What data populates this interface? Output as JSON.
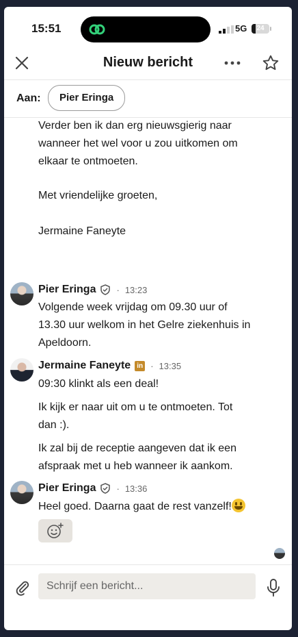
{
  "status_bar": {
    "time": "15:51",
    "network": "5G",
    "battery": "24",
    "battery_level": 0.24
  },
  "header": {
    "title": "Nieuw bericht"
  },
  "recipient": {
    "label": "Aan:",
    "name": "Pier Eringa"
  },
  "draft_tail": {
    "line1": "Verder ben ik dan erg nieuwsgierig naar",
    "line2": "wanneer het wel voor u zou uitkomen om",
    "line3": "elkaar te ontmoeten.",
    "closing": "Met vriendelijke groeten,",
    "signature": "Jermaine Faneyte"
  },
  "messages": [
    {
      "sender": "Pier Eringa",
      "time": "13:23",
      "lines": [
        "Volgende week vrijdag om 09.30 uur of",
        "13.30 uur welkom in het Gelre ziekenhuis in",
        "Apeldoorn."
      ]
    },
    {
      "sender": "Jermaine Faneyte",
      "badge": "in",
      "time": "13:35",
      "p1": "09:30 klinkt als een deal!",
      "p2": [
        "Ik kijk er naar uit om u te ontmoeten. Tot",
        "dan :)."
      ],
      "p3": [
        "Ik zal bij de receptie aangeven dat ik een",
        "afspraak met u heb wanneer ik aankom."
      ]
    },
    {
      "sender": "Pier Eringa",
      "time": "13:36",
      "text": "Heel goed. Daarna gaat de rest vanzelf!"
    }
  ],
  "separator": "·",
  "composer": {
    "placeholder": "Schrijf een bericht..."
  },
  "colors": {
    "premium_badge": "#c48a2a",
    "reaction_bg": "#e6e3de",
    "input_bg": "#eeece8"
  },
  "icons": [
    "close-icon",
    "more-icon",
    "star-icon",
    "verified-shield-icon",
    "add-reaction-icon",
    "paperclip-icon",
    "microphone-icon"
  ]
}
